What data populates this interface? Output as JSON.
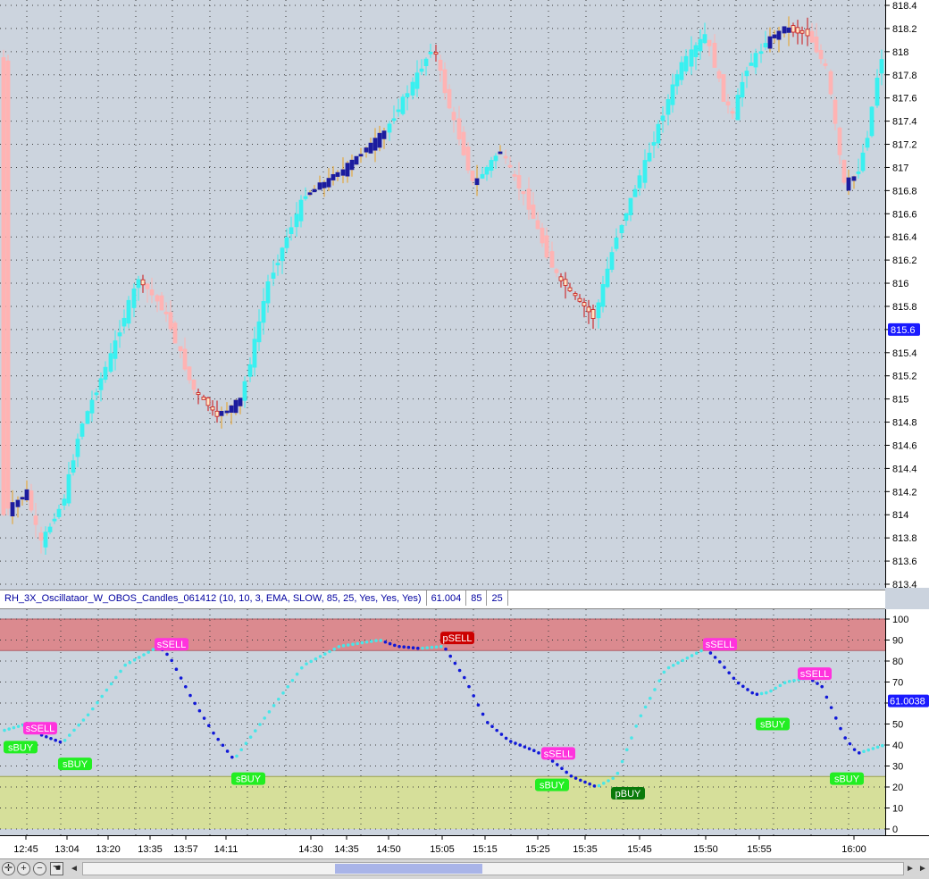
{
  "colors": {
    "bg": "#ccd4de",
    "grid": "#3c3c3c",
    "bull_dark": "#1c1c9e",
    "bull_cyan": "#39f0f0",
    "bear_fill": "#ffe6c4",
    "bear_outline": "#c81818",
    "bear_pink": "#ffb3b3",
    "wick_up": "#e8a020",
    "wick_down": "#cc1111",
    "ob_zone": "#db8a8f",
    "os_zone": "#d6df9a",
    "osc_up": "#48e6e8",
    "osc_down": "#1018d8"
  },
  "price_axis": {
    "ticks": [
      "818.4",
      "818.2",
      "818",
      "817.8",
      "817.6",
      "817.4",
      "817.2",
      "817",
      "816.8",
      "816.6",
      "816.4",
      "816.2",
      "816",
      "815.8",
      "815.6",
      "815.4",
      "815.2",
      "815",
      "814.8",
      "814.6",
      "814.4",
      "814.2",
      "814",
      "813.8",
      "813.6",
      "813.4"
    ],
    "current_price": "815.6"
  },
  "indicator": {
    "title": "RH_3X_Oscillataor_W_OBOS_Candles_061412 (10, 10, 3, EMA, SLOW, 85, 25, Yes, Yes, Yes)",
    "value": "61.004",
    "ob_level": "85",
    "os_level": "25",
    "axis_ticks": [
      "100",
      "90",
      "80",
      "70",
      "60",
      "50",
      "40",
      "30",
      "20",
      "10",
      "0"
    ],
    "current_value": "61.0038",
    "signals": [
      {
        "label": "sSELL",
        "type": "sell"
      },
      {
        "label": "sBUY",
        "type": "buy"
      },
      {
        "label": "sBUY",
        "type": "buy"
      },
      {
        "label": "sSELL",
        "type": "sell"
      },
      {
        "label": "sBUY",
        "type": "buy"
      },
      {
        "label": "pSELL",
        "type": "psell"
      },
      {
        "label": "sSELL",
        "type": "sell"
      },
      {
        "label": "sBUY",
        "type": "buy"
      },
      {
        "label": "pBUY",
        "type": "pbuy"
      },
      {
        "label": "sSELL",
        "type": "sell"
      },
      {
        "label": "sBUY",
        "type": "buy"
      },
      {
        "label": "sSELL",
        "type": "sell"
      },
      {
        "label": "sBUY",
        "type": "buy"
      }
    ]
  },
  "time_axis": {
    "labels": [
      "12:45",
      "13:04",
      "13:20",
      "13:35",
      "13:57",
      "14:11",
      "14:30",
      "14:35",
      "14:50",
      "15:05",
      "15:15",
      "15:25",
      "15:35",
      "15:45",
      "15:50",
      "15:55",
      "16:00"
    ]
  },
  "toolbar": {
    "zoom_in_icon": "zoom-in-icon",
    "zoom_out_icon": "zoom-out-icon",
    "pan_icon": "hand-icon",
    "scroll_left": "◄",
    "scroll_right": "►"
  }
}
